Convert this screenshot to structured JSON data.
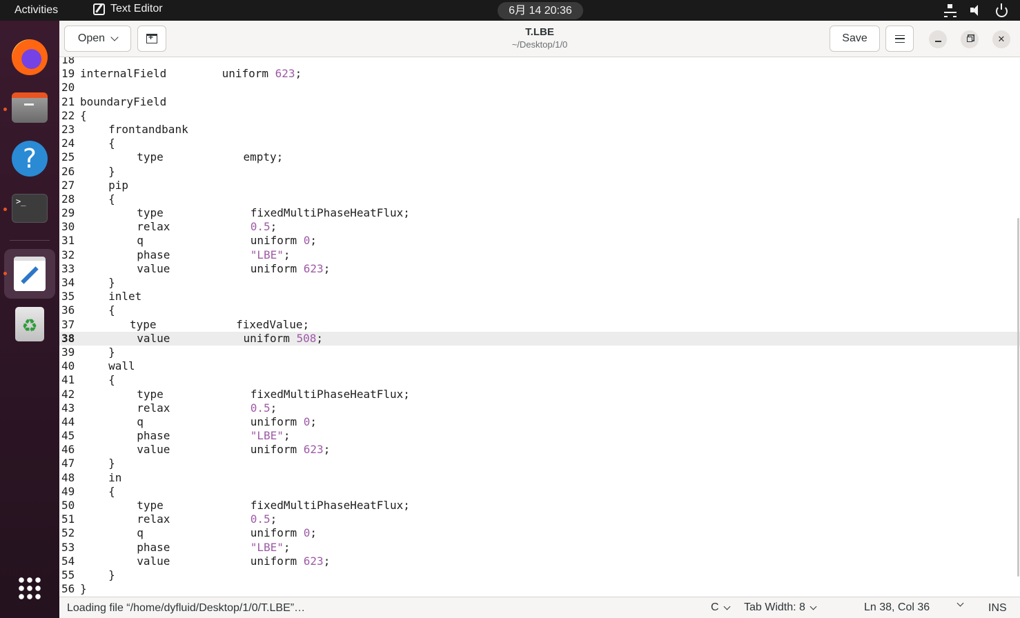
{
  "topbar": {
    "activities": "Activities",
    "app_name": "Text Editor",
    "clock": "6月 14  20:36"
  },
  "dock": {
    "items": [
      "firefox",
      "files",
      "help",
      "terminal",
      "text-editor",
      "trash",
      "show-apps"
    ]
  },
  "header": {
    "open_label": "Open",
    "title": "T.LBE",
    "path": "~/Desktop/1/0",
    "save_label": "Save"
  },
  "editor": {
    "current_line": 38,
    "lines": [
      {
        "n": "18",
        "a": "",
        "b": "",
        "ai": 0,
        "bc": 0
      },
      {
        "n": "19",
        "a": "internalField",
        "b": "uniform 623;",
        "ai": 0,
        "bc": 20
      },
      {
        "n": "20",
        "a": "",
        "b": "",
        "ai": 0,
        "bc": 0
      },
      {
        "n": "21",
        "a": "boundaryField",
        "b": "",
        "ai": 0,
        "bc": 0
      },
      {
        "n": "22",
        "a": "{",
        "b": "",
        "ai": 0,
        "bc": 0
      },
      {
        "n": "23",
        "a": "frontandbank",
        "b": "",
        "ai": 4,
        "bc": 0
      },
      {
        "n": "24",
        "a": "{",
        "b": "",
        "ai": 4,
        "bc": 0
      },
      {
        "n": "25",
        "a": "type",
        "b": "empty;",
        "ai": 8,
        "bc": 23
      },
      {
        "n": "26",
        "a": "}",
        "b": "",
        "ai": 4,
        "bc": 0
      },
      {
        "n": "27",
        "a": "pip",
        "b": "",
        "ai": 4,
        "bc": 0
      },
      {
        "n": "28",
        "a": "{",
        "b": "",
        "ai": 4,
        "bc": 0
      },
      {
        "n": "29",
        "a": "type",
        "b": "fixedMultiPhaseHeatFlux;",
        "ai": 8,
        "bc": 24
      },
      {
        "n": "30",
        "a": "relax",
        "b": "0.5;",
        "ai": 8,
        "bc": 24
      },
      {
        "n": "31",
        "a": "q",
        "b": "uniform 0;",
        "ai": 8,
        "bc": 24
      },
      {
        "n": "32",
        "a": "phase",
        "b": "\"LBE\";",
        "ai": 8,
        "bc": 24
      },
      {
        "n": "33",
        "a": "value",
        "b": "uniform 623;",
        "ai": 8,
        "bc": 24
      },
      {
        "n": "34",
        "a": "}",
        "b": "",
        "ai": 4,
        "bc": 0
      },
      {
        "n": "35",
        "a": "inlet",
        "b": "",
        "ai": 4,
        "bc": 0
      },
      {
        "n": "36",
        "a": "{",
        "b": "",
        "ai": 4,
        "bc": 0
      },
      {
        "n": "37",
        "a": "type",
        "b": "fixedValue;",
        "ai": 7,
        "bc": 22
      },
      {
        "n": "38",
        "a": "value",
        "b": "uniform 508;",
        "ai": 8,
        "bc": 23
      },
      {
        "n": "39",
        "a": "}",
        "b": "",
        "ai": 4,
        "bc": 0
      },
      {
        "n": "40",
        "a": "wall",
        "b": "",
        "ai": 4,
        "bc": 0
      },
      {
        "n": "41",
        "a": "{",
        "b": "",
        "ai": 4,
        "bc": 0
      },
      {
        "n": "42",
        "a": "type",
        "b": "fixedMultiPhaseHeatFlux;",
        "ai": 8,
        "bc": 24
      },
      {
        "n": "43",
        "a": "relax",
        "b": "0.5;",
        "ai": 8,
        "bc": 24
      },
      {
        "n": "44",
        "a": "q",
        "b": "uniform 0;",
        "ai": 8,
        "bc": 24
      },
      {
        "n": "45",
        "a": "phase",
        "b": "\"LBE\";",
        "ai": 8,
        "bc": 24
      },
      {
        "n": "46",
        "a": "value",
        "b": "uniform 623;",
        "ai": 8,
        "bc": 24
      },
      {
        "n": "47",
        "a": "}",
        "b": "",
        "ai": 4,
        "bc": 0
      },
      {
        "n": "48",
        "a": "in",
        "b": "",
        "ai": 4,
        "bc": 0
      },
      {
        "n": "49",
        "a": "{",
        "b": "",
        "ai": 4,
        "bc": 0
      },
      {
        "n": "50",
        "a": "type",
        "b": "fixedMultiPhaseHeatFlux;",
        "ai": 8,
        "bc": 24
      },
      {
        "n": "51",
        "a": "relax",
        "b": "0.5;",
        "ai": 8,
        "bc": 24
      },
      {
        "n": "52",
        "a": "q",
        "b": "uniform 0;",
        "ai": 8,
        "bc": 24
      },
      {
        "n": "53",
        "a": "phase",
        "b": "\"LBE\";",
        "ai": 8,
        "bc": 24
      },
      {
        "n": "54",
        "a": "value",
        "b": "uniform 623;",
        "ai": 8,
        "bc": 24
      },
      {
        "n": "55",
        "a": "}",
        "b": "",
        "ai": 4,
        "bc": 0
      },
      {
        "n": "56",
        "a": "}",
        "b": "",
        "ai": 0,
        "bc": 0
      }
    ]
  },
  "statusbar": {
    "message": "Loading file “/home/dyfluid/Desktop/1/0/T.LBE”…",
    "language": "C",
    "tab_width": "Tab Width: 8",
    "position": "Ln 38, Col 36",
    "mode": "INS"
  },
  "colors": {
    "number": "#9e5aa6",
    "string": "#9e5aa6",
    "accent": "#e95420"
  }
}
